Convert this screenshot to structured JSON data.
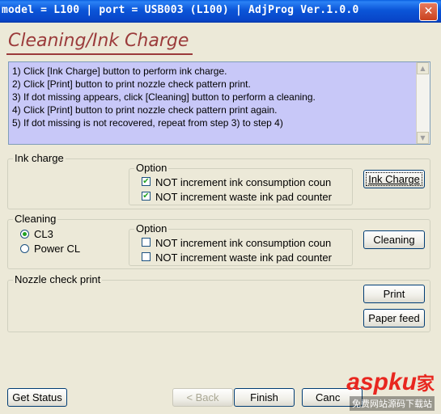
{
  "window": {
    "title": "model = L100 | port = USB003 (L100) | AdjProg Ver.1.0.0",
    "close_glyph": "✕"
  },
  "header": {
    "title": "Cleaning/Ink Charge"
  },
  "instructions": [
    "1) Click [Ink Charge] button to perform ink charge.",
    "2) Click [Print] button to print nozzle check pattern print.",
    "3) If dot missing appears, click [Cleaning] button to perform a cleaning.",
    "4) Click [Print] button to print nozzle check pattern print again.",
    "5) If dot missing is not recovered, repeat from step 3) to step 4)"
  ],
  "ink_charge": {
    "legend": "Ink charge",
    "option_legend": "Option",
    "options": [
      {
        "label": "NOT increment ink consumption coun",
        "checked": true
      },
      {
        "label": "NOT increment waste ink pad counter",
        "checked": true
      }
    ],
    "button": "Ink Charge"
  },
  "cleaning": {
    "legend": "Cleaning",
    "radios": [
      {
        "label": "CL3",
        "selected": true
      },
      {
        "label": "Power CL",
        "selected": false
      }
    ],
    "option_legend": "Option",
    "options": [
      {
        "label": "NOT increment ink consumption coun",
        "checked": false
      },
      {
        "label": "NOT increment waste ink pad counter",
        "checked": false
      }
    ],
    "button": "Cleaning"
  },
  "nozzle": {
    "legend": "Nozzle check print",
    "print_button": "Print",
    "paper_feed_button": "Paper feed"
  },
  "footer": {
    "get_status": "Get Status",
    "back": "< Back",
    "finish": "Finish",
    "cancel": "Canc"
  },
  "watermark": {
    "brand": "aspku",
    "brand_cn": "家",
    "sub": "免费网站源码下载站"
  }
}
